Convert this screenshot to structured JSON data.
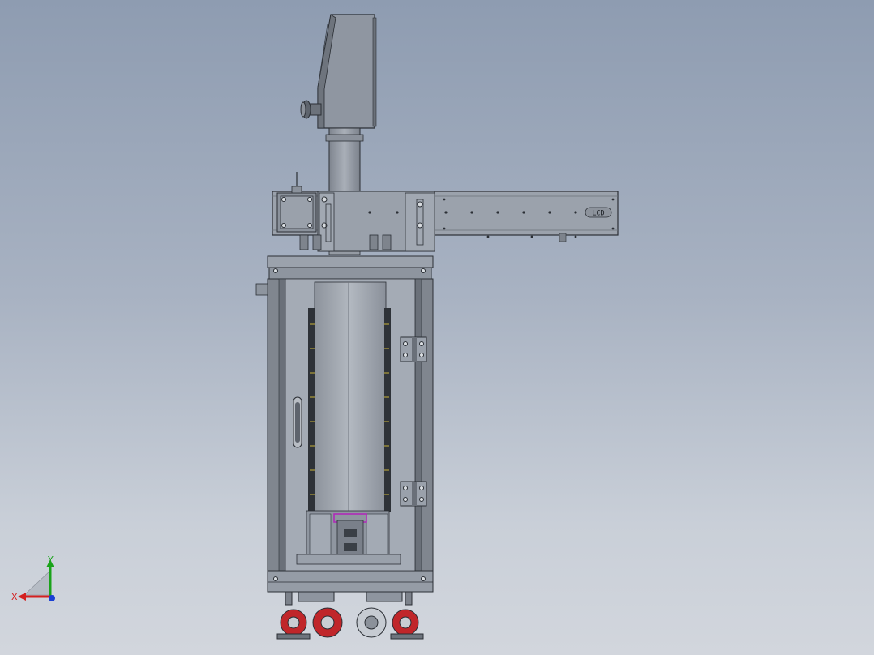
{
  "viewport": {
    "background_top": "#8e9cb1",
    "background_bottom": "#d2d6dd"
  },
  "triad": {
    "x_label": "X",
    "y_label": "Y",
    "x_color": "#d42020",
    "y_color": "#1aa31a",
    "z_color": "#1a3fd4"
  },
  "model": {
    "name_tag": "LCD",
    "frame_color": "#7d828c",
    "panel_color": "#9aa2ac",
    "wheel_color": "#c0262a",
    "highlight_color": "#b02ab8"
  }
}
